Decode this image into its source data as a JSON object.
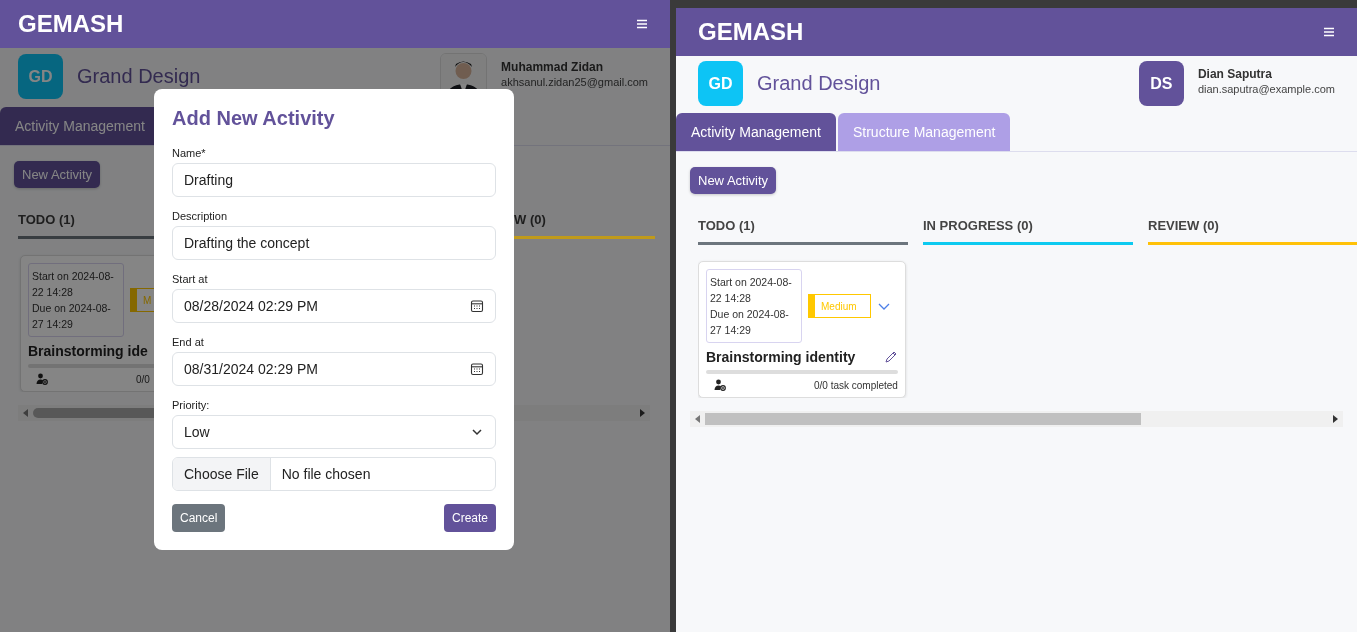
{
  "windows": [
    {
      "brand": "GEMASH",
      "project": {
        "initials": "GD",
        "name": "Grand Design"
      },
      "user": {
        "name": "Muhammad Zidan",
        "email": "akhsanul.zidan25@gmail.com"
      },
      "tabs": [
        {
          "label": "Activity Management",
          "selected": true
        }
      ],
      "new_button": "New Activity",
      "columns": [
        {
          "title": "TODO (1)",
          "color": "#383d41",
          "cards": [
            {
              "start": "Start on 2024-08-22 14:28",
              "due": "Due on 2024-08-27 14:29",
              "priority": "M",
              "title": "Brainstorming ide",
              "level": 0,
              "progress": "0/0",
              "toggle": false,
              "edit": false
            }
          ]
        },
        {
          "title": "W (0)",
          "color": "#c09a1a"
        }
      ],
      "modal": {
        "title": "Add New Activity",
        "fields": [
          {
            "kind": "text",
            "label": "Name*",
            "value": "Drafting"
          },
          {
            "kind": "text",
            "label": "Description",
            "value": "Drafting the concept"
          },
          {
            "kind": "datetime",
            "label": "Start at",
            "value": "08/28/2024 02:29  PM"
          },
          {
            "kind": "datetime",
            "label": "End at",
            "value": "08/31/2024 02:29  PM"
          },
          {
            "kind": "select",
            "label": "Priority:",
            "value": "Low"
          },
          {
            "kind": "file",
            "button": "Choose File",
            "value": "No file chosen"
          }
        ],
        "cancel": "Cancel",
        "submit": "Create"
      }
    },
    {
      "brand": "GEMASH",
      "project": {
        "initials": "GD",
        "name": "Grand Design"
      },
      "user": {
        "avatar": {
          "kind": "initials",
          "initials": "DS"
        },
        "name": "Dian Saputra",
        "email": "dian.saputra@example.com"
      },
      "tabs": [
        {
          "label": "Activity Management",
          "selected": true
        },
        {
          "label": "Structure Management",
          "selected": false
        }
      ],
      "new_button": "New Activity",
      "columns": [
        {
          "title": "TODO (1)",
          "color": "#6c757d",
          "cards": [
            {
              "start": "Start on 2024-08-22 14:28",
              "due": "Due on 2024-08-27 14:29",
              "priority": "Medium",
              "title": "Brainstorming identity",
              "level": 0,
              "progress": "0/0 task completed",
              "toggle": true,
              "edit": true
            }
          ]
        },
        {
          "title": "IN PROGRESS (0)",
          "color": "#0dcaf0"
        },
        {
          "title": "REVIEW (0)",
          "color": "#ffc107"
        }
      ]
    }
  ]
}
